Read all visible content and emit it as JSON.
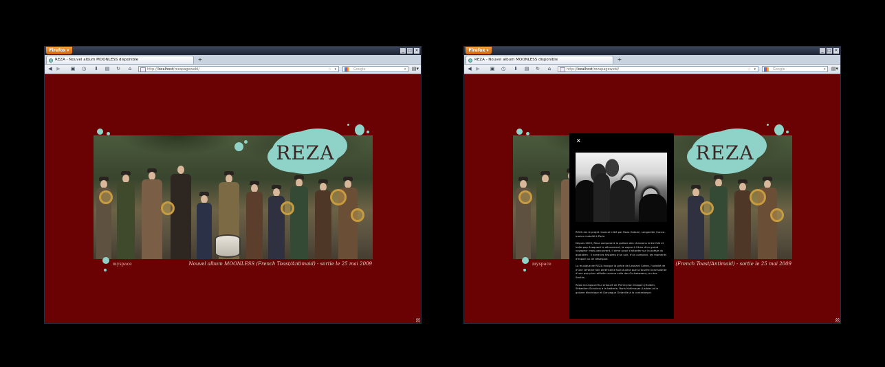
{
  "browser": {
    "menu_label": "Firefox ▾",
    "tab_title": "REZA - Nouvel album MOONLESS disponible",
    "new_tab": "+",
    "url_prefix": "http://",
    "url_host": "localhost",
    "url_path": "/rezapagewebl/",
    "search_placeholder": "Google",
    "window_controls": {
      "minimize": "_",
      "maximize": "□",
      "close": "✕"
    },
    "nav_icons": [
      "back-icon",
      "forward-icon",
      "sidebar-icon",
      "history-icon",
      "download-icon",
      "screenshot-icon",
      "reload-icon",
      "home-icon",
      "page-icon",
      "star-icon",
      "search-icon",
      "menu-icon"
    ]
  },
  "site": {
    "logo": "REZA",
    "myspace_link": "myspace",
    "album_line": "Nouvel album MOONLESS (French Toast/Antimaid) - sortie le 25 mai 2009",
    "brand_color": "#8fd3c8",
    "background_color": "#6a0204"
  },
  "overlay": {
    "close": "×",
    "paragraphs": [
      "REZA est le projet musical initié par Reza Hatami, songwriter franco-iranien installé à Paris.",
      "Depuis 2005, Reza compose à la guitare des chansons entre folk et indie-pop évoquant le dénuement, la vague à l'âme d'un grand voyageur mais parcourant, il aime aussi s'attarder sur la poésie du quotidien : il narre les histoires d'un soir, d'un comptoir, les moments d'espoir ou de désespoir.",
      "La musique de REZA évoque la grâce de Leonard Cohen, l'acidité de d'une certaine folk américaine tout autant que la touche nonchalante d'une pop plus raffinée comme celle des Go-betweens, ou des Smiths.",
      "Reza est aujourd'hui entouré de Pierre-Jean Grappin (Holden, Sébastien Schuller) à la batterie, Boris Kohlmayer (Ladder) à la guitare électrique et Gonzague Octaville à la contrebasse."
    ]
  }
}
